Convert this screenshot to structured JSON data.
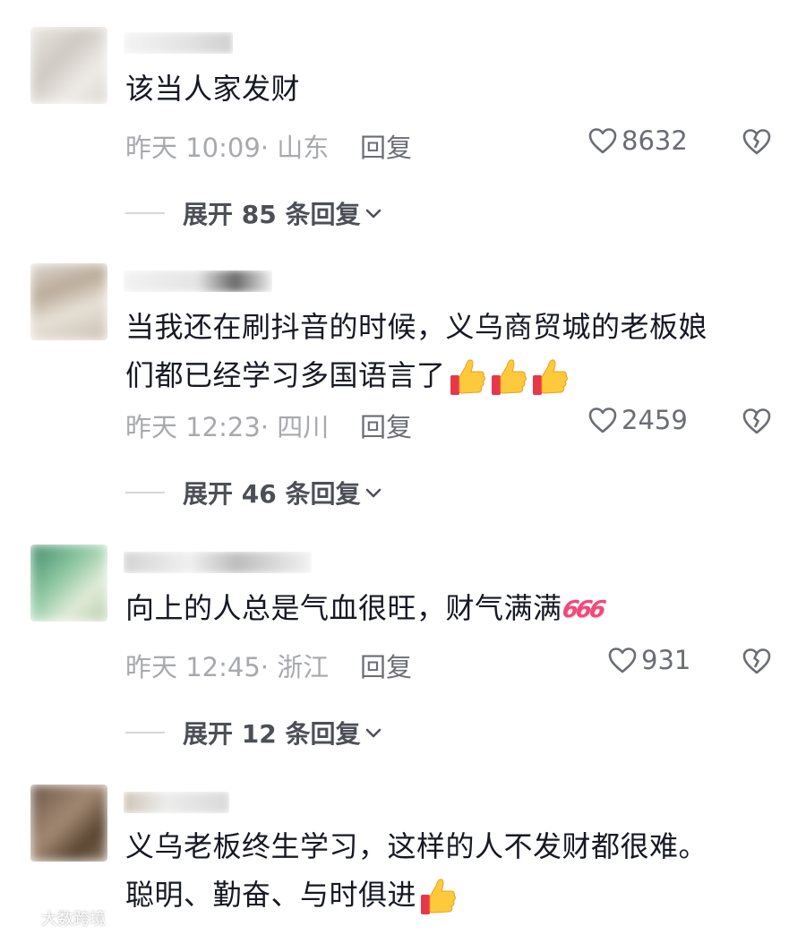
{
  "comments": [
    {
      "text_lines": [
        "该当人家发财"
      ],
      "time": "昨天 10:09",
      "location": "山东",
      "reply_label": "回复",
      "likes": "8632",
      "expand_label": "展开 85 条回复"
    },
    {
      "text_lines": [
        "当我还在刷抖音的时候，义乌商贸城的老板娘",
        "们都已经学习多国语言了"
      ],
      "emoji": [
        "thumbs-up",
        "thumbs-up",
        "thumbs-up"
      ],
      "time": "昨天 12:23",
      "location": "四川",
      "reply_label": "回复",
      "likes": "2459",
      "expand_label": "展开 46 条回复"
    },
    {
      "text_lines": [
        "向上的人总是气血很旺，财气满满"
      ],
      "emoji_text": "666",
      "time": "昨天 12:45",
      "location": "浙江",
      "reply_label": "回复",
      "likes": "931",
      "expand_label": "展开 12 条回复"
    },
    {
      "text_lines": [
        "义乌老板终生学习，这样的人不发财都很难。",
        "聪明、勤奋、与时俱进"
      ],
      "emoji": [
        "thumbs-up"
      ]
    }
  ],
  "watermark": "大数跨境",
  "colors": {
    "text": "#161823",
    "meta": "#a8a9ad",
    "action": "#6b6d75",
    "emoji_666": "#f04a7a"
  }
}
